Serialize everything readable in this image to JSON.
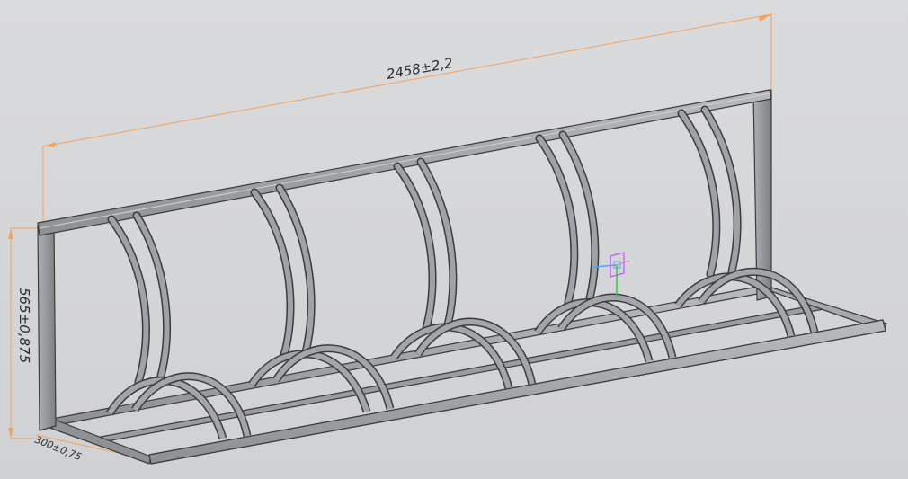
{
  "viewport": {
    "background": "#d3d4d6",
    "model_color": "#9ea0a3",
    "dimension_color": "#f5a25c"
  },
  "dimensions": {
    "length": "2458±2,2",
    "height": "565±0,875",
    "depth": "300±0,75"
  },
  "gizmo": {
    "icon": "coordinate-system-icon",
    "axis_colors": [
      "#4aa8ff",
      "#35c83a",
      "#c850ff"
    ]
  }
}
